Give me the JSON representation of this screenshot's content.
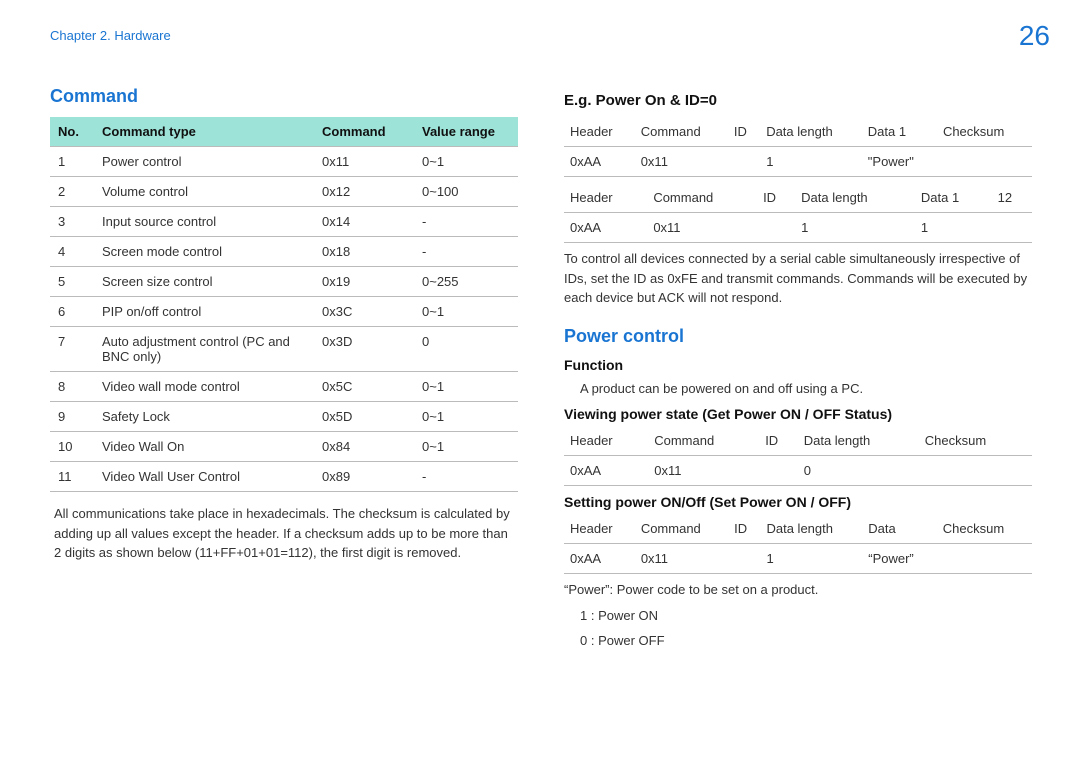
{
  "header": {
    "chapter": "Chapter 2. Hardware",
    "page": "26"
  },
  "left": {
    "title": "Command",
    "table_headers": [
      "No.",
      "Command type",
      "Command",
      "Value range"
    ],
    "rows": [
      {
        "no": "1",
        "type": "Power control",
        "cmd": "0x11",
        "range": "0~1"
      },
      {
        "no": "2",
        "type": "Volume control",
        "cmd": "0x12",
        "range": "0~100"
      },
      {
        "no": "3",
        "type": "Input source control",
        "cmd": "0x14",
        "range": "-"
      },
      {
        "no": "4",
        "type": "Screen mode control",
        "cmd": "0x18",
        "range": "-"
      },
      {
        "no": "5",
        "type": "Screen size control",
        "cmd": "0x19",
        "range": "0~255"
      },
      {
        "no": "6",
        "type": "PIP on/off control",
        "cmd": "0x3C",
        "range": "0~1"
      },
      {
        "no": "7",
        "type": "Auto adjustment control (PC and BNC only)",
        "cmd": "0x3D",
        "range": "0"
      },
      {
        "no": "8",
        "type": "Video wall mode control",
        "cmd": "0x5C",
        "range": "0~1"
      },
      {
        "no": "9",
        "type": "Safety Lock",
        "cmd": "0x5D",
        "range": "0~1"
      },
      {
        "no": "10",
        "type": "Video Wall On",
        "cmd": "0x84",
        "range": "0~1"
      },
      {
        "no": "11",
        "type": "Video Wall User Control",
        "cmd": "0x89",
        "range": "-"
      }
    ],
    "note": "All communications take place in hexadecimals. The checksum is calculated by adding up all values except the header. If a checksum adds up to be more than 2 digits as shown below (11+FF+01+01=112), the first digit is removed."
  },
  "right": {
    "eg_title": "E.g. Power On & ID=0",
    "eg_table1": {
      "headers": [
        "Header",
        "Command",
        "ID",
        "Data length",
        "Data 1",
        "Checksum"
      ],
      "row": [
        "0xAA",
        "0x11",
        "",
        "1",
        "\"Power\"",
        ""
      ]
    },
    "eg_table2": {
      "headers": [
        "Header",
        "Command",
        "ID",
        "Data length",
        "Data 1",
        "12"
      ],
      "row": [
        "0xAA",
        "0x11",
        "",
        "1",
        "1",
        ""
      ]
    },
    "eg_note": "To control all devices connected by a serial cable simultaneously irrespective of IDs, set the ID as  0xFE  and transmit commands. Commands will be executed by each device but ACK will not respond.",
    "pc_title": "Power control",
    "pc_function_label": "Function",
    "pc_function_text": "A product can be powered on and off using a PC.",
    "pc_view_title": "Viewing power state (Get Power ON / OFF Status)",
    "pc_view_table": {
      "headers": [
        "Header",
        "Command",
        "ID",
        "Data length",
        "Checksum"
      ],
      "row": [
        "0xAA",
        "0x11",
        "",
        "0",
        ""
      ]
    },
    "pc_set_title": "Setting power ON/Off (Set Power ON / OFF)",
    "pc_set_table": {
      "headers": [
        "Header",
        "Command",
        "ID",
        "Data length",
        "Data",
        "Checksum"
      ],
      "row": [
        "0xAA",
        "0x11",
        "",
        "1",
        "“Power”",
        ""
      ]
    },
    "pc_desc": "“Power”: Power code to be set on a product.",
    "pc_on": "1 : Power ON",
    "pc_off": "0 : Power OFF"
  }
}
